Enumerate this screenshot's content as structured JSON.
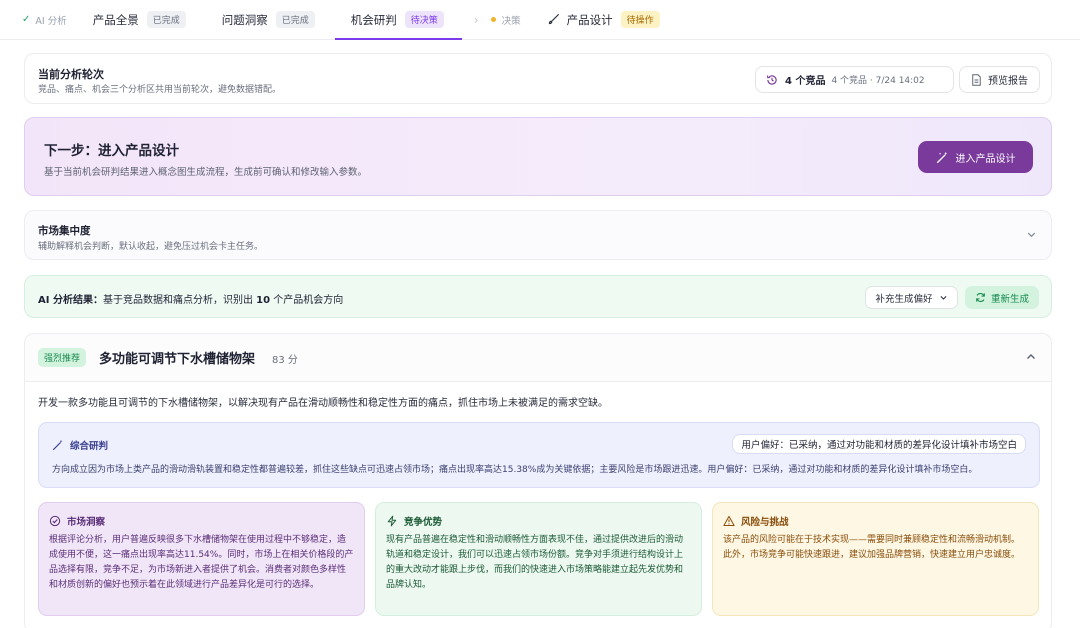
{
  "steps": {
    "ai": "AI 分析",
    "overview": "产品全景",
    "overview_status": "已完成",
    "insight": "问题洞察",
    "insight_status": "已完成",
    "opportunity": "机会研判",
    "opportunity_status": "待决策",
    "decision": "决策",
    "design": "产品设计",
    "design_status": "待操作"
  },
  "round": {
    "title": "当前分析轮次",
    "subtitle": "竞品、痛点、机会三个分析区共用当前轮次，避免数据错配。",
    "count": "4 个竞品",
    "meta": "4 个竞品 · 7/24 14:02",
    "preview": "预览报告"
  },
  "next": {
    "title": "下一步：进入产品设计",
    "subtitle": "基于当前机会研判结果进入概念图生成流程，生成前可确认和修改输入参数。",
    "button": "进入产品设计"
  },
  "market": {
    "title": "市场集中度",
    "subtitle": "辅助解释机会判断，默认收起，避免压过机会卡主任务。"
  },
  "ai_result": {
    "label": "AI 分析结果：",
    "prefix": "基于竞品数据和痛点分析，识别出",
    "count": "10",
    "suffix": "个产品机会方向",
    "pref_button": "补充生成偏好",
    "regen_button": "重新生成"
  },
  "opportunity": {
    "badge": "强烈推荐",
    "title": "多功能可调节下水槽储物架",
    "score": "83 分",
    "description": "开发一款多功能且可调节的下水槽储物架，以解决现有产品在滑动顺畅性和稳定性方面的痛点，抓住市场上未被满足的需求空缺。",
    "synthesis": {
      "title": "综合研判",
      "pill": "用户偏好：已采纳，通过对功能和材质的差异化设计填补市场空白",
      "text": "方向成立因为市场上类产品的滑动滑轨装置和稳定性都普遍较差，抓住这些缺点可迅速占领市场；痛点出现率高达15.38%成为关键依据；主要风险是市场跟进迅速。用户偏好：已采纳，通过对功能和材质的差异化设计填补市场空白。"
    },
    "insight": {
      "title": "市场洞察",
      "text": "根据评论分析，用户普遍反映很多下水槽储物架在使用过程中不够稳定，造成使用不便，这一痛点出现率高达11.54%。同时，市场上在相关价格段的产品选择有限，竞争不足，为市场新进入者提供了机会。消费者对颜色多样性和材质创新的偏好也预示着在此领域进行产品差异化是可行的选择。"
    },
    "advantage": {
      "title": "竞争优势",
      "text": "现有产品普遍在稳定性和滑动顺畅性方面表现不佳，通过提供改进后的滑动轨道和稳定设计，我们可以迅速占领市场份额。竞争对手须进行结构设计上的重大改动才能跟上步伐，而我们的快速进入市场策略能建立起先发优势和品牌认知。"
    },
    "risk": {
      "title": "风险与挑战",
      "text": "该产品的风险可能在于技术实现——需要同时兼顾稳定性和流畅滑动机制。此外，市场竞争可能快速跟进，建议加强品牌营销，快速建立用户忠诚度。"
    }
  }
}
